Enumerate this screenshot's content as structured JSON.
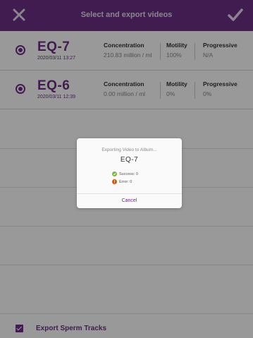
{
  "header": {
    "title": "Select and export videos",
    "close_icon": "close-icon",
    "confirm_icon": "checkmark-icon"
  },
  "videos": [
    {
      "name": "EQ-7",
      "date": "2020/03/11 13:27",
      "concentration_label": "Concentration",
      "concentration_value": "210.83 million / ml",
      "motility_label": "Motility",
      "motility_value": "100%",
      "progressive_label": "Progressive",
      "progressive_value": "N/A"
    },
    {
      "name": "EQ-6",
      "date": "2020/03/11 12:39",
      "concentration_label": "Concentration",
      "concentration_value": "0.00 million / ml",
      "motility_label": "Motility",
      "motility_value": "0%",
      "progressive_label": "Progressive",
      "progressive_value": "0%"
    }
  ],
  "footer": {
    "export_tracks_label": "Export Sperm Tracks",
    "export_tracks_checked": true
  },
  "modal": {
    "heading": "Exporting Video to Album...",
    "video_name": "EQ-7",
    "success_text": "Success: 0",
    "error_text": "Error: 0",
    "cancel_label": "Cancel"
  },
  "colors": {
    "brand": "#6b2f85",
    "success": "#7cb342",
    "error": "#e65100"
  }
}
